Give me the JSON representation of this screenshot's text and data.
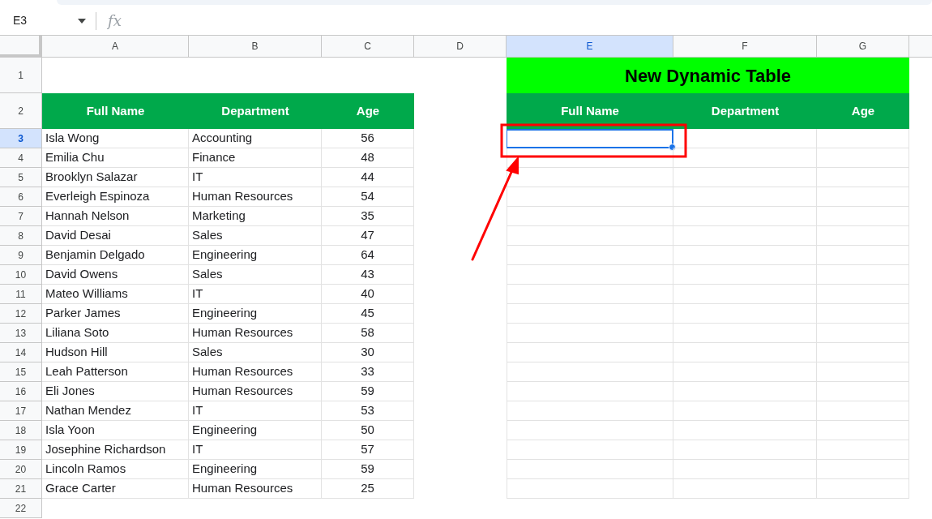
{
  "formula_bar": {
    "name_box": "E3",
    "fx": "fx"
  },
  "column_headers": [
    {
      "label": "A",
      "selected": false
    },
    {
      "label": "B",
      "selected": false
    },
    {
      "label": "C",
      "selected": false
    },
    {
      "label": "D",
      "selected": false
    },
    {
      "label": "E",
      "selected": true
    },
    {
      "label": "F",
      "selected": false
    },
    {
      "label": "G",
      "selected": false
    }
  ],
  "row_headers": [
    {
      "label": "1",
      "selected": false
    },
    {
      "label": "2",
      "selected": false
    },
    {
      "label": "3",
      "selected": true
    },
    {
      "label": "4",
      "selected": false
    },
    {
      "label": "5",
      "selected": false
    },
    {
      "label": "6",
      "selected": false
    },
    {
      "label": "7",
      "selected": false
    },
    {
      "label": "8",
      "selected": false
    },
    {
      "label": "9",
      "selected": false
    },
    {
      "label": "10",
      "selected": false
    },
    {
      "label": "11",
      "selected": false
    },
    {
      "label": "12",
      "selected": false
    },
    {
      "label": "13",
      "selected": false
    },
    {
      "label": "14",
      "selected": false
    },
    {
      "label": "15",
      "selected": false
    },
    {
      "label": "16",
      "selected": false
    },
    {
      "label": "17",
      "selected": false
    },
    {
      "label": "18",
      "selected": false
    },
    {
      "label": "19",
      "selected": false
    },
    {
      "label": "20",
      "selected": false
    },
    {
      "label": "21",
      "selected": false
    },
    {
      "label": "22",
      "selected": false
    }
  ],
  "source_table": {
    "columns": [
      "Full Name",
      "Department",
      "Age"
    ],
    "rows": [
      [
        "Isla Wong",
        "Accounting",
        "56"
      ],
      [
        "Emilia Chu",
        "Finance",
        "48"
      ],
      [
        "Brooklyn Salazar",
        "IT",
        "44"
      ],
      [
        "Everleigh Espinoza",
        "Human Resources",
        "54"
      ],
      [
        "Hannah Nelson",
        "Marketing",
        "35"
      ],
      [
        "David Desai",
        "Sales",
        "47"
      ],
      [
        "Benjamin Delgado",
        "Engineering",
        "64"
      ],
      [
        "David Owens",
        "Sales",
        "43"
      ],
      [
        "Mateo Williams",
        "IT",
        "40"
      ],
      [
        "Parker James",
        "Engineering",
        "45"
      ],
      [
        "Liliana Soto",
        "Human Resources",
        "58"
      ],
      [
        "Hudson Hill",
        "Sales",
        "30"
      ],
      [
        "Leah Patterson",
        "Human Resources",
        "33"
      ],
      [
        "Eli Jones",
        "Human Resources",
        "59"
      ],
      [
        "Nathan Mendez",
        "IT",
        "53"
      ],
      [
        "Isla Yoon",
        "Engineering",
        "50"
      ],
      [
        "Josephine Richardson",
        "IT",
        "57"
      ],
      [
        "Lincoln Ramos",
        "Engineering",
        "59"
      ],
      [
        "Grace Carter",
        "Human Resources",
        "25"
      ]
    ]
  },
  "dynamic_table": {
    "title": "New Dynamic Table",
    "columns": [
      "Full Name",
      "Department",
      "Age"
    ],
    "rows": [
      {
        "cells": [
          {
            "selected": true
          },
          {
            "selected": false
          },
          {
            "selected": false
          }
        ]
      },
      {
        "cells": [
          {
            "selected": false
          },
          {
            "selected": false
          },
          {
            "selected": false
          }
        ]
      },
      {
        "cells": [
          {
            "selected": false
          },
          {
            "selected": false
          },
          {
            "selected": false
          }
        ]
      },
      {
        "cells": [
          {
            "selected": false
          },
          {
            "selected": false
          },
          {
            "selected": false
          }
        ]
      },
      {
        "cells": [
          {
            "selected": false
          },
          {
            "selected": false
          },
          {
            "selected": false
          }
        ]
      },
      {
        "cells": [
          {
            "selected": false
          },
          {
            "selected": false
          },
          {
            "selected": false
          }
        ]
      },
      {
        "cells": [
          {
            "selected": false
          },
          {
            "selected": false
          },
          {
            "selected": false
          }
        ]
      },
      {
        "cells": [
          {
            "selected": false
          },
          {
            "selected": false
          },
          {
            "selected": false
          }
        ]
      },
      {
        "cells": [
          {
            "selected": false
          },
          {
            "selected": false
          },
          {
            "selected": false
          }
        ]
      },
      {
        "cells": [
          {
            "selected": false
          },
          {
            "selected": false
          },
          {
            "selected": false
          }
        ]
      },
      {
        "cells": [
          {
            "selected": false
          },
          {
            "selected": false
          },
          {
            "selected": false
          }
        ]
      },
      {
        "cells": [
          {
            "selected": false
          },
          {
            "selected": false
          },
          {
            "selected": false
          }
        ]
      },
      {
        "cells": [
          {
            "selected": false
          },
          {
            "selected": false
          },
          {
            "selected": false
          }
        ]
      },
      {
        "cells": [
          {
            "selected": false
          },
          {
            "selected": false
          },
          {
            "selected": false
          }
        ]
      },
      {
        "cells": [
          {
            "selected": false
          },
          {
            "selected": false
          },
          {
            "selected": false
          }
        ]
      },
      {
        "cells": [
          {
            "selected": false
          },
          {
            "selected": false
          },
          {
            "selected": false
          }
        ]
      },
      {
        "cells": [
          {
            "selected": false
          },
          {
            "selected": false
          },
          {
            "selected": false
          }
        ]
      },
      {
        "cells": [
          {
            "selected": false
          },
          {
            "selected": false
          },
          {
            "selected": false
          }
        ]
      },
      {
        "cells": [
          {
            "selected": false
          },
          {
            "selected": false
          },
          {
            "selected": false
          }
        ]
      }
    ]
  }
}
